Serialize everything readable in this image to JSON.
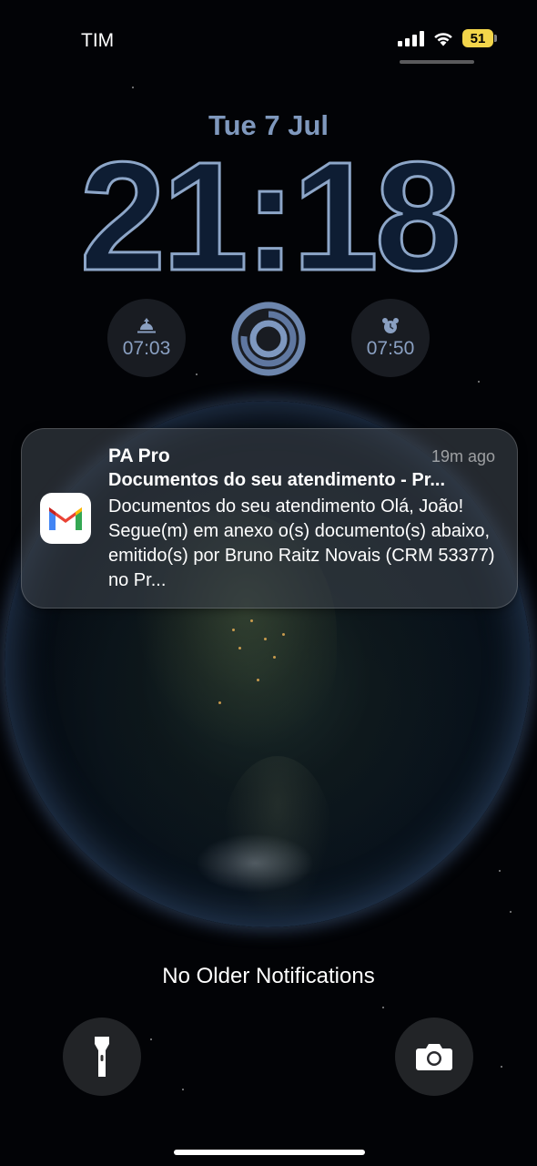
{
  "status_bar": {
    "carrier": "TIM",
    "battery_level": "51",
    "battery_color": "#f3d54a",
    "signal_bars": 4,
    "wifi": "wifi-icon"
  },
  "lockscreen": {
    "date": "Tue 7 Jul",
    "time": "21:18",
    "time_color": "#8da6c8"
  },
  "widgets": {
    "sunrise": {
      "icon": "sunrise-icon",
      "label": "07:03"
    },
    "activity": {
      "icon": "activity-rings-icon"
    },
    "alarm": {
      "icon": "alarm-clock-icon",
      "label": "07:50"
    }
  },
  "notification": {
    "app_icon": "gmail-icon",
    "app_name": "PA Pro",
    "time_ago": "19m ago",
    "subject": "Documentos do seu atendimento - Pr...",
    "body": "Documentos do seu atendimento Olá, João! Segue(m) em anexo o(s) documento(s) abaixo, emitido(s) por Bruno Raitz Novais (CRM 53377) no Pr..."
  },
  "footer": {
    "no_older": "No Older Notifications",
    "left_button": "flashlight-icon",
    "right_button": "camera-icon"
  }
}
